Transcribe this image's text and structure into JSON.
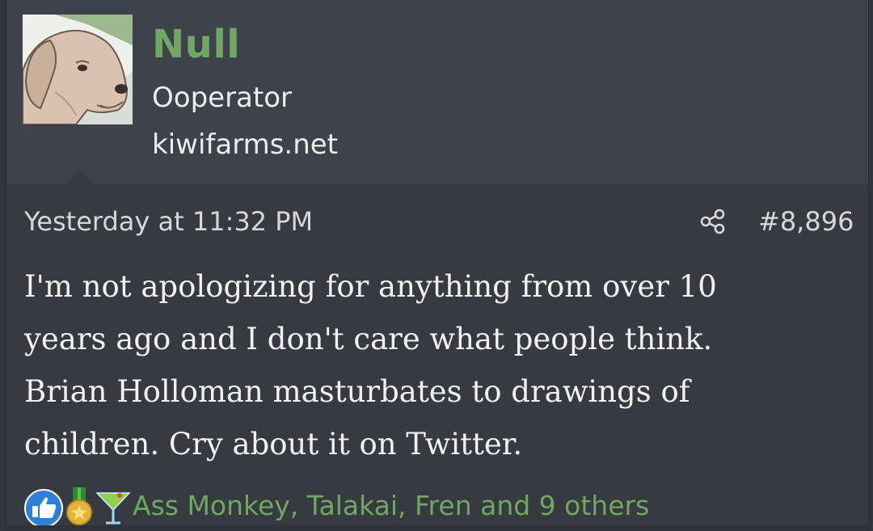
{
  "user": {
    "name": "Null",
    "title": "Ooperator",
    "site": "kiwifarms.net",
    "avatar_icon": "dog-avatar-icon"
  },
  "post": {
    "date": "Yesterday at 11:32 PM",
    "number": "#8,896",
    "body_lines": [
      "I'm not apologizing for anything from over 10",
      "years ago and I don't care what people think.",
      "Brian Holloman masturbates to drawings of",
      "children. Cry about it on Twitter."
    ]
  },
  "reactions": {
    "icons": [
      "thumbs-up-icon",
      "medal-icon",
      "cocktail-icon"
    ],
    "names": "Ass Monkey, Talakai, Fren and 9 others"
  },
  "colors": {
    "page": "#32353c",
    "post": "#373a41",
    "user_block": "#3e424a",
    "accent_green": "#6fa763",
    "text": "#f1f1f1"
  }
}
